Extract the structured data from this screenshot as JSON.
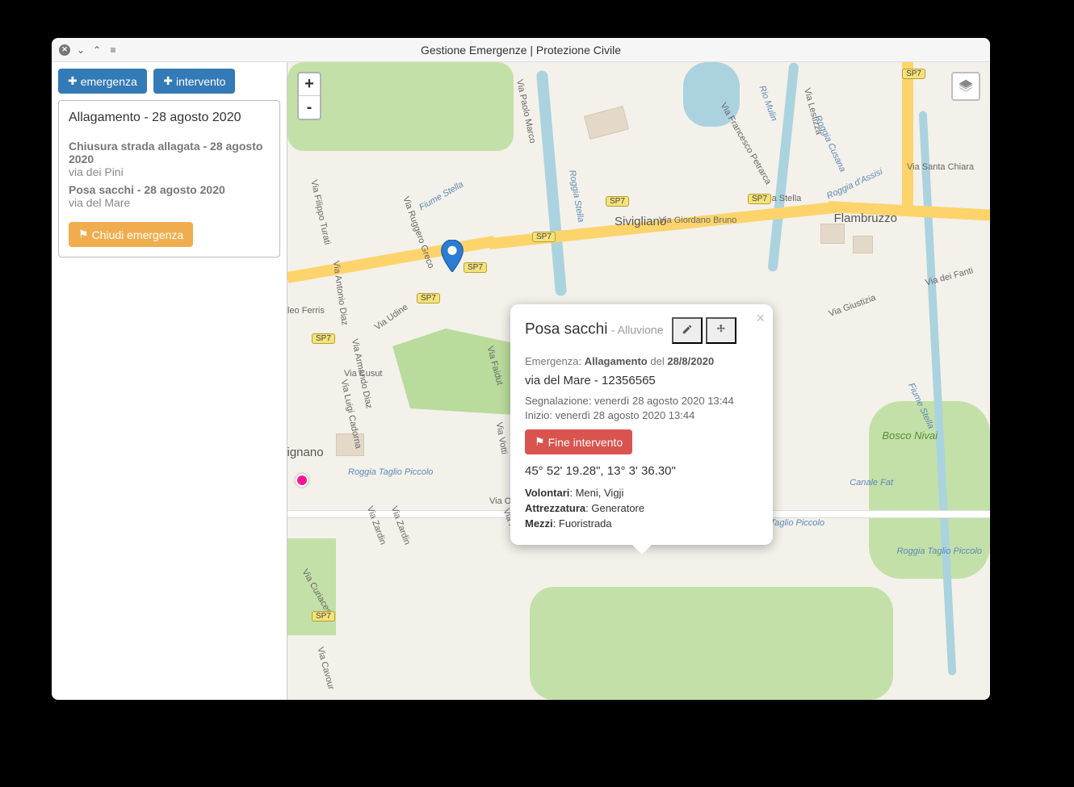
{
  "window": {
    "title": "Gestione Emergenze | Protezione Civile"
  },
  "toolbar": {
    "btn_emergenza": "emergenza",
    "btn_intervento": "intervento"
  },
  "card": {
    "title": "Allagamento - 28 agosto 2020",
    "items": [
      {
        "title": "Chiusura strada allagata - 28 agosto 2020",
        "sub": "via dei Pini"
      },
      {
        "title": "Posa sacchi - 28 agosto 2020",
        "sub": "via del Mare"
      }
    ],
    "close_btn": "Chiudi emergenza"
  },
  "popup": {
    "title": "Posa sacchi",
    "subtitle": "- Alluvione",
    "emergency_label": "Emergenza:",
    "emergency_name": "Allagamento",
    "del_label": "del",
    "date": "28/8/2020",
    "address": "via del Mare - 12356565",
    "seg": "Segnalazione: venerdì 28 agosto 2020 13:44",
    "inizio": "Inizio: venerdì 28 agosto 2020 13:44",
    "end_btn": "Fine intervento",
    "coords": "45° 52' 19.28\", 13° 3' 36.30\"",
    "volontari_label": "Volontari",
    "volontari": ": Meni, Vigji",
    "attrezzatura_label": "Attrezzatura",
    "attrezzatura": ": Generatore",
    "mezzi_label": "Mezzi",
    "mezzi": ": Fuoristrada"
  },
  "zoom": {
    "in": "+",
    "out": "-"
  },
  "shields": {
    "sp7": "SP7"
  },
  "map_labels": {
    "sivigliano": "Sivigliano",
    "flambruzzo": "Flambruzzo",
    "bosco_nivai": "Bosco Nivai",
    "via_stella": "Via Stella",
    "via_giordano_bruno": "Via Giordano Bruno",
    "via_santa_chiara": "Via Santa Chiara",
    "via_giustizia": "Via Giustizia",
    "via_dei_fanti": "Via dei Fanti",
    "via_udine": "Via Udine",
    "via_cusut": "Via Cusut",
    "via_faidut": "Via Faidut",
    "via_votti": "Via Votti",
    "via_lestizza": "Via Lestizza",
    "via_francesco_petrarca": "Via Francesco Petrarca",
    "roggia_cusana": "Roggia Cusana",
    "roggia_stella": "Roggia Stella",
    "fiume_stella": "Fiume Stella",
    "fiume_stella2": "Fiume Stella",
    "rio_mulin": "Rio Mulin",
    "roggia_taglio_piccolo": "Roggia Taglio Piccolo",
    "roggia_taglio_piccolo2": "Roggia Taglio Piccolo",
    "roggia_taglio_piccolo3": "Roggia Taglio Piccolo",
    "canale_fat": "Canale Fat",
    "roggia_dassili": "Roggia d'Assisi",
    "via_ottavo": "Via Ottavo Reggimento Bersaglieri",
    "via_zardin": "Via Zardin",
    "via_zardin2": "Via Zardin",
    "via_fait": "Via Fait",
    "via_cavour": "Via Cavour",
    "via_curiaces": "Via Curiaces",
    "via_ruggero_greco": "Via Ruggero Greco",
    "via_antonio_diaz": "Via Antonio Diaz",
    "via_armando_diaz": "Via Armando Diaz",
    "via_luigi_cadorna": "Via Luigi Cadorna",
    "via_filippo_turati": "Via Filippo Turati",
    "leoferris": "leo Ferris",
    "vignano": "vignano",
    "via_paolo_marco": "Via Paolo Marco"
  }
}
